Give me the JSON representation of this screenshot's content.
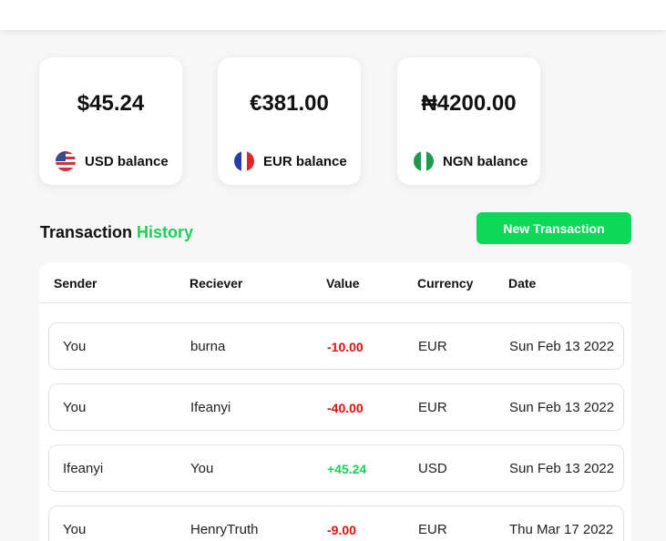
{
  "balances": [
    {
      "amount": "$45.24",
      "label": "USD balance",
      "flag": "us-flag-icon"
    },
    {
      "amount": "€381.00",
      "label": "EUR balance",
      "flag": "france-flag-icon"
    },
    {
      "amount": "₦4200.00",
      "label": "NGN balance",
      "flag": "nigeria-flag-icon"
    }
  ],
  "history": {
    "title_part1": "Transaction ",
    "title_part2": "History",
    "new_button": "New Transaction"
  },
  "table": {
    "headers": [
      "Sender",
      "Reciever",
      "Value",
      "Currency",
      "Date"
    ],
    "rows": [
      {
        "sender": "You",
        "receiver": "burna",
        "value": "-10.00",
        "currency": "EUR",
        "date": "Sun Feb 13 2022"
      },
      {
        "sender": "You",
        "receiver": "Ifeanyi",
        "value": "-40.00",
        "currency": "EUR",
        "date": "Sun Feb 13 2022"
      },
      {
        "sender": "Ifeanyi",
        "receiver": "You",
        "value": "+45.24",
        "currency": "USD",
        "date": "Sun Feb 13 2022"
      },
      {
        "sender": "You",
        "receiver": "HenryTruth",
        "value": "-9.00",
        "currency": "EUR",
        "date": "Thu Mar 17 2022"
      }
    ]
  },
  "colors": {
    "accent_green": "#1fcf5a",
    "button_green": "#0ed85a",
    "negative_red": "#e10d0d"
  }
}
